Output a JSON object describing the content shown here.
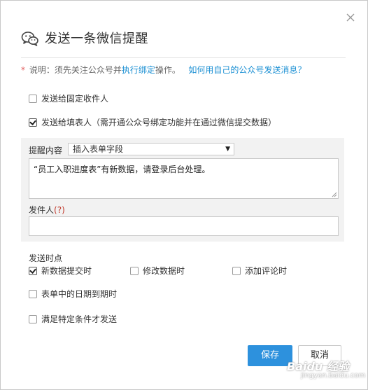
{
  "dialog": {
    "title": "发送一条微信提醒",
    "title_icon": "wechat-icon",
    "close_icon": "close-icon"
  },
  "note": {
    "star": "*",
    "prefix": "说明：须先关注公众号并",
    "link1": "执行绑定",
    "suffix": "操作。",
    "link2": "如何用自己的公众号发送消息？"
  },
  "recipients": {
    "fixed_label": "发送给固定收件人",
    "fixed_checked": false,
    "filler_label": "发送给填表人（需开通公众号绑定功能并在通过微信提交数据）",
    "filler_checked": true
  },
  "content": {
    "label": "提醒内容",
    "insert_select": "插入表单字段",
    "message": "“员工入职进度表”有新数据，请登录后台处理。",
    "sender_label": "发件人",
    "sender_hint": "(?)",
    "sender_value": ""
  },
  "timing": {
    "label": "发送时点",
    "new_data_label": "新数据提交时",
    "new_data_checked": true,
    "modify_label": "修改数据时",
    "modify_checked": false,
    "comment_label": "添加评论时",
    "comment_checked": false,
    "date_due_label": "表单中的日期到期时",
    "date_due_checked": false,
    "condition_label": "满足特定条件才发送",
    "condition_checked": false
  },
  "buttons": {
    "save": "保存",
    "cancel": "取消"
  },
  "watermark": {
    "brand": "Baidu 经验",
    "url": "jingyan.baidu.com"
  },
  "colors": {
    "primary": "#2d91dd",
    "link": "#1a8fd3",
    "required_star": "#e25e5e"
  }
}
